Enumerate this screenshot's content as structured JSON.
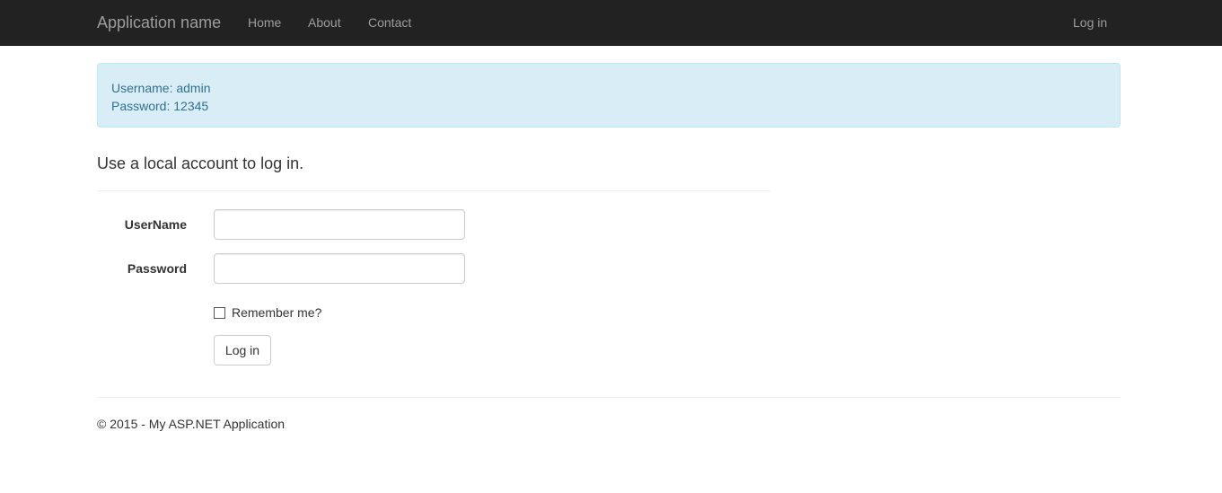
{
  "navbar": {
    "brand": "Application name",
    "links": [
      {
        "label": "Home"
      },
      {
        "label": "About"
      },
      {
        "label": "Contact"
      }
    ],
    "login_label": "Log in",
    "background_color": "#222222",
    "link_color": "#9d9d9d"
  },
  "alert": {
    "line1": "Username: admin",
    "line2": "Password: 12345",
    "background_color": "#d9edf7",
    "text_color": "#31708f"
  },
  "form": {
    "title": "Use a local account to log in.",
    "username_label": "UserName",
    "username_value": "",
    "password_label": "Password",
    "password_value": "",
    "remember_label": "Remember me?",
    "remember_checked": false,
    "submit_label": "Log in"
  },
  "footer": {
    "text": "© 2015 - My ASP.NET Application"
  }
}
